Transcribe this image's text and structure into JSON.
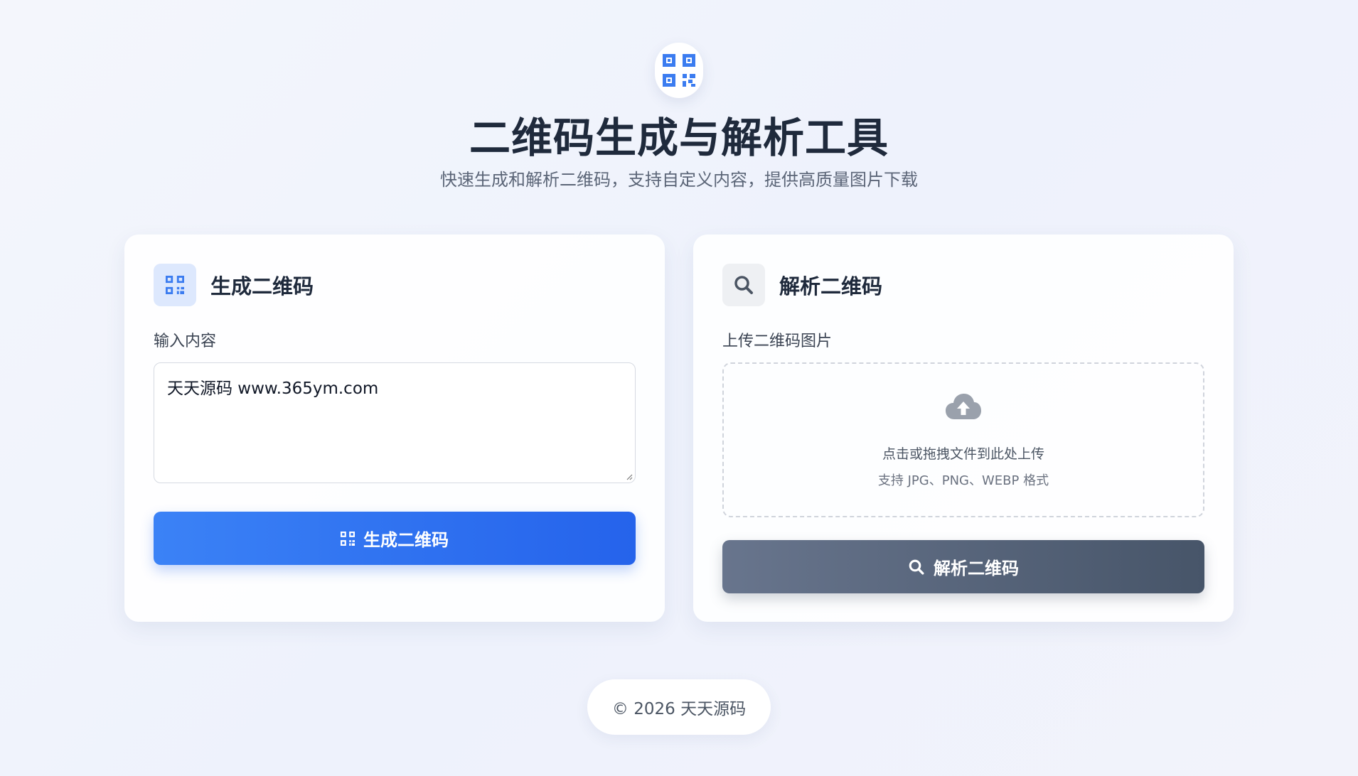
{
  "header": {
    "logo_icon": "qrcode-icon",
    "title": "二维码生成与解析工具",
    "subtitle": "快速生成和解析二维码，支持自定义内容，提供高质量图片下载"
  },
  "generate": {
    "icon": "qrcode-icon",
    "title": "生成二维码",
    "input_label": "输入内容",
    "input_value": "天天源码 www.365ym.com",
    "button_icon": "qrcode-icon",
    "button_label": "生成二维码"
  },
  "parse": {
    "icon": "search-icon",
    "title": "解析二维码",
    "upload_label": "上传二维码图片",
    "upload_icon": "cloud-upload-icon",
    "upload_hint": "点击或拖拽文件到此处上传",
    "upload_formats": "支持 JPG、PNG、WEBP 格式",
    "button_icon": "search-icon",
    "button_label": "解析二维码"
  },
  "footer": {
    "copyright": "© 2026 天天源码"
  },
  "colors": {
    "primary": "#2563eb",
    "primary_light": "#3b82f6",
    "secondary": "#475569",
    "title": "#1f2a3c"
  }
}
